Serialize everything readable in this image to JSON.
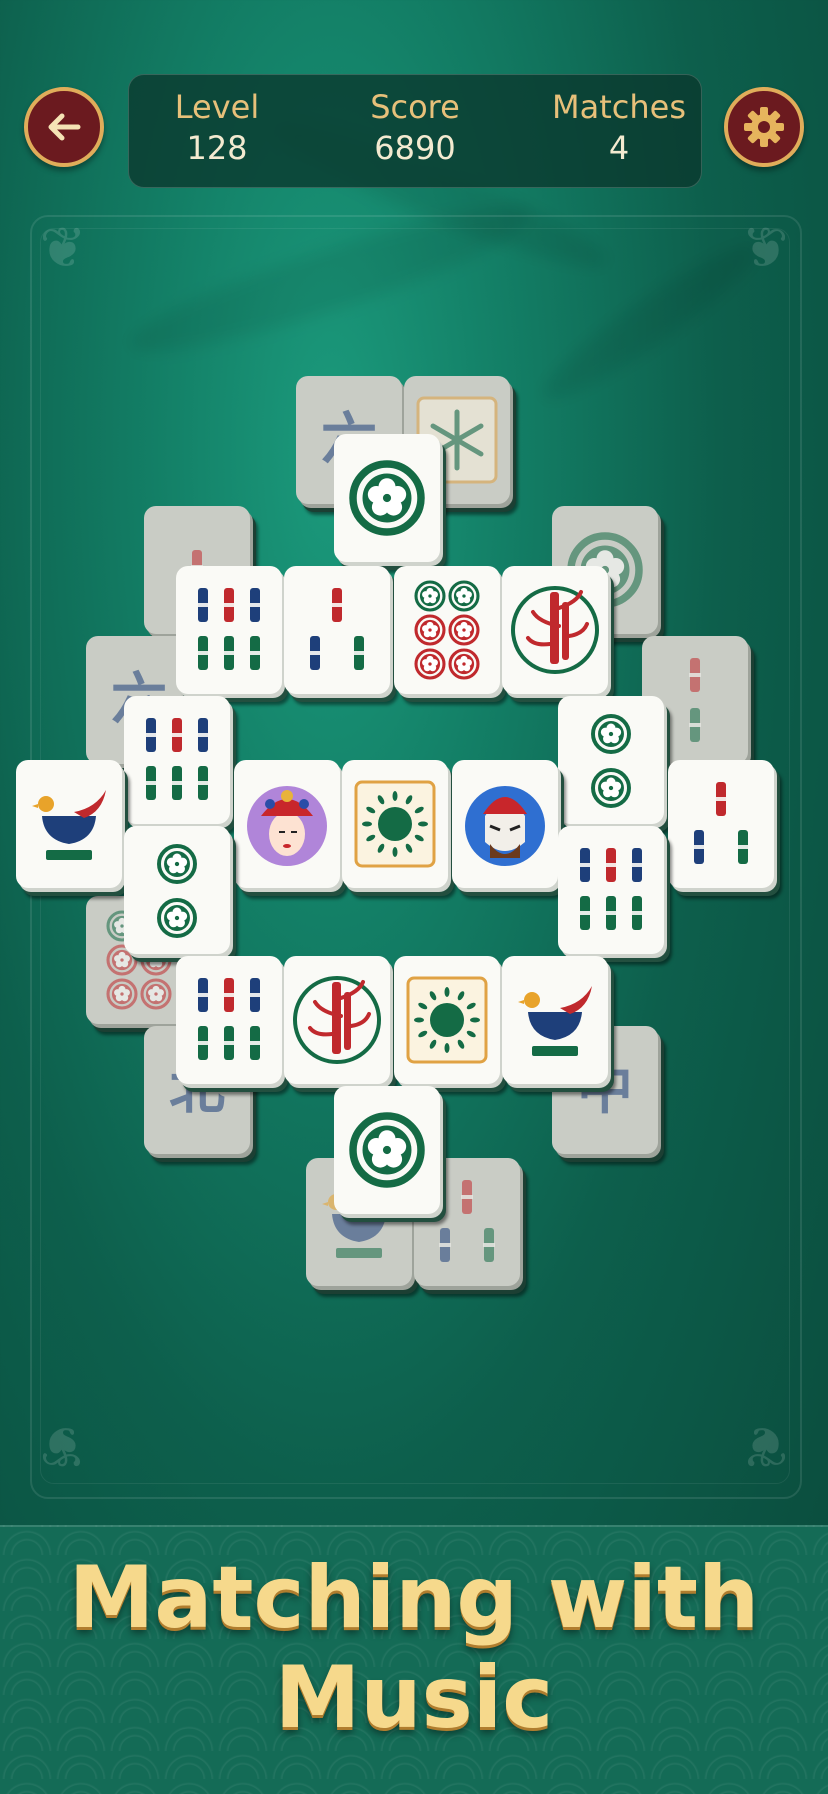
{
  "header": {
    "back_icon": "arrow-left-icon",
    "settings_icon": "gear-icon",
    "stats": [
      {
        "label": "Level",
        "value": "128"
      },
      {
        "label": "Score",
        "value": "6890"
      },
      {
        "label": "Matches",
        "value": "4"
      }
    ]
  },
  "board": {
    "tiles": [
      {
        "layer": "under",
        "symbol": "character",
        "char": "六"
      },
      {
        "layer": "under",
        "symbol": "snowflake"
      },
      {
        "layer": "under",
        "symbol": "bamboo-1"
      },
      {
        "layer": "under",
        "symbol": "circle-1"
      },
      {
        "layer": "under",
        "symbol": "character",
        "char": "六"
      },
      {
        "layer": "under",
        "symbol": "bamboo-2"
      },
      {
        "layer": "under",
        "symbol": "circle-6"
      },
      {
        "layer": "under",
        "symbol": "character",
        "char": "北"
      },
      {
        "layer": "under",
        "symbol": "character",
        "char": "中"
      },
      {
        "layer": "under",
        "symbol": "bird"
      },
      {
        "layer": "under",
        "symbol": "bamboo-3"
      },
      {
        "layer": "top",
        "symbol": "circle-1"
      },
      {
        "layer": "top",
        "symbol": "bamboo-6"
      },
      {
        "layer": "top",
        "symbol": "bamboo-3"
      },
      {
        "layer": "top",
        "symbol": "circle-6"
      },
      {
        "layer": "top",
        "symbol": "bamboo-plant"
      },
      {
        "layer": "top",
        "symbol": "bamboo-6"
      },
      {
        "layer": "top",
        "symbol": "circle-2"
      },
      {
        "layer": "top",
        "symbol": "bird"
      },
      {
        "layer": "top",
        "symbol": "opera-mask-lady"
      },
      {
        "layer": "top",
        "symbol": "sun-flower"
      },
      {
        "layer": "top",
        "symbol": "opera-mask-warrior"
      },
      {
        "layer": "top",
        "symbol": "bamboo-3"
      },
      {
        "layer": "top",
        "symbol": "circle-2"
      },
      {
        "layer": "top",
        "symbol": "bamboo-6"
      },
      {
        "layer": "top",
        "symbol": "bamboo-6"
      },
      {
        "layer": "top",
        "symbol": "bamboo-plant"
      },
      {
        "layer": "top",
        "symbol": "sun-flower"
      },
      {
        "layer": "top",
        "symbol": "bird"
      },
      {
        "layer": "top",
        "symbol": "circle-1"
      }
    ]
  },
  "banner": {
    "line1": "Matching with",
    "line2": "Music"
  },
  "colors": {
    "accent_gold": "#e0ad5a",
    "button_red": "#6b1a1f",
    "tile_red": "#c0292d",
    "tile_green": "#146b45",
    "tile_blue": "#1e3f7a"
  }
}
